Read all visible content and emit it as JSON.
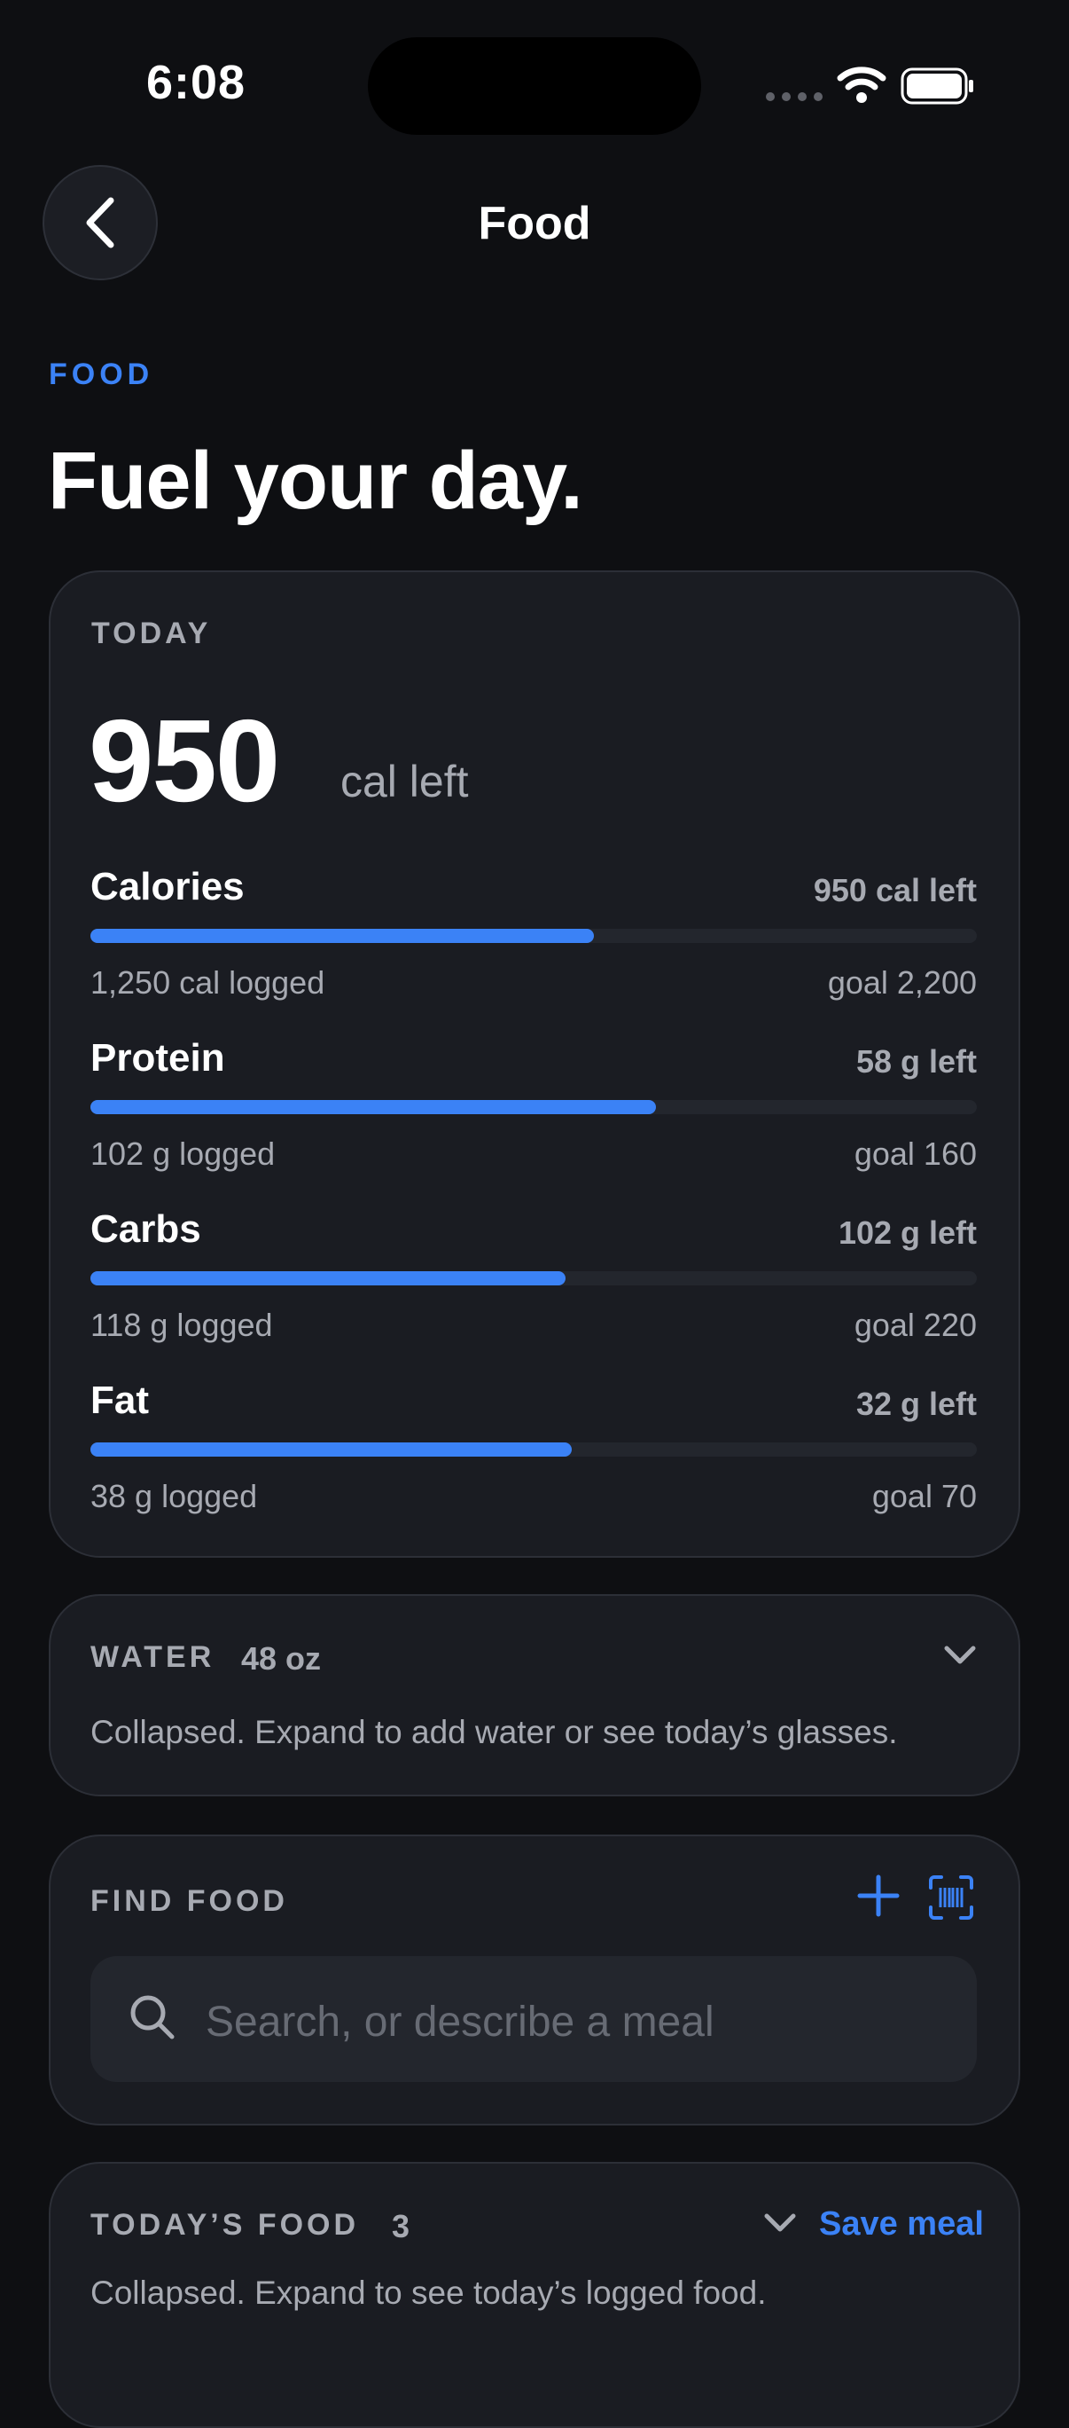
{
  "status_bar": {
    "time": "6:08"
  },
  "nav": {
    "title": "Food"
  },
  "header": {
    "eyebrow": "FOOD",
    "headline": "Fuel your day."
  },
  "today": {
    "label": "TODAY",
    "big_value": "950",
    "big_unit": "cal left",
    "macros": [
      {
        "name": "Calories",
        "left": "950 cal left",
        "logged": "1,250 cal logged",
        "goal": "goal 2,200",
        "progress": 0.568
      },
      {
        "name": "Protein",
        "left": "58 g left",
        "logged": "102 g logged",
        "goal": "goal 160",
        "progress": 0.6375
      },
      {
        "name": "Carbs",
        "left": "102 g left",
        "logged": "118 g logged",
        "goal": "goal 220",
        "progress": 0.536
      },
      {
        "name": "Fat",
        "left": "32 g left",
        "logged": "38 g logged",
        "goal": "goal 70",
        "progress": 0.543
      }
    ]
  },
  "water": {
    "label": "WATER",
    "amount": "48 oz",
    "description": "Collapsed. Expand to add water or see today’s glasses."
  },
  "find_food": {
    "label": "FIND FOOD",
    "search_placeholder": "Search, or describe a meal"
  },
  "todays_food": {
    "label": "TODAY’S FOOD",
    "count": "3",
    "save_label": "Save meal",
    "description": "Collapsed. Expand to see today’s logged food."
  },
  "colors": {
    "accent": "#3b82f6",
    "background": "#0e0f12",
    "card": "#1a1c22"
  }
}
